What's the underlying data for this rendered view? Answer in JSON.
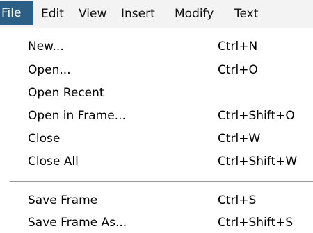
{
  "menubar": {
    "items": [
      "File",
      "Edit",
      "View",
      "Insert",
      "Modify",
      "Text"
    ],
    "active": "File"
  },
  "file_menu": {
    "items": [
      {
        "label": "New...",
        "shortcut": "Ctrl+N"
      },
      {
        "label": "Open...",
        "shortcut": "Ctrl+O"
      },
      {
        "label": "Open Recent",
        "shortcut": ""
      },
      {
        "label": "Open in Frame...",
        "shortcut": "Ctrl+Shift+O"
      },
      {
        "label": "Close",
        "shortcut": "Ctrl+W"
      },
      {
        "label": "Close All",
        "shortcut": "Ctrl+Shift+W"
      },
      {
        "label": "Save Frame",
        "shortcut": "Ctrl+S"
      },
      {
        "label": "Save Frame As...",
        "shortcut": "Ctrl+Shift+S"
      }
    ]
  },
  "colors": {
    "active_menu_background": "#2b5f86",
    "active_menu_text": "#ffffff",
    "menubar_background": "#f3f3f3"
  }
}
